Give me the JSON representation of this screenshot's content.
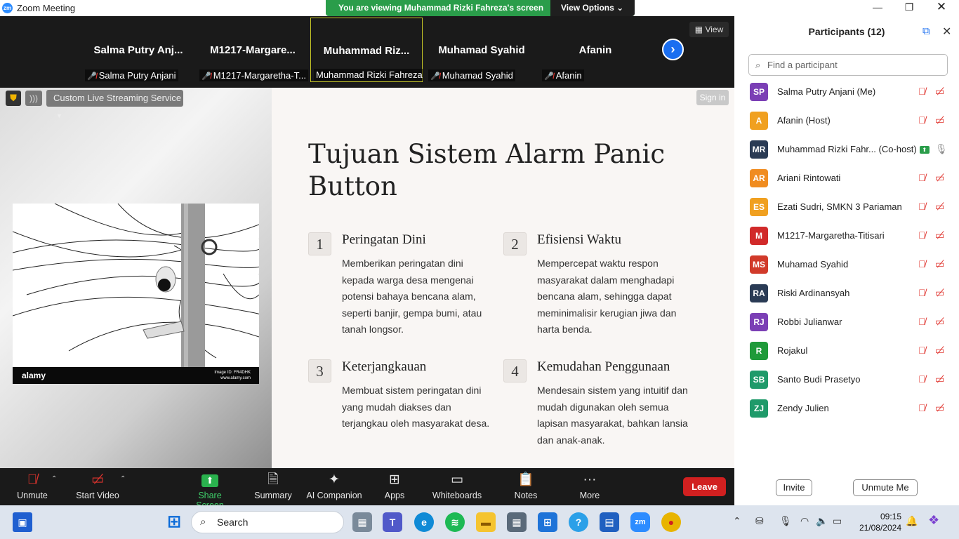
{
  "titlebar": {
    "app_icon": "zm",
    "title": "Zoom Meeting",
    "viewing": "You are viewing Muhammad Rizki Fahreza's screen",
    "view_options": "View Options"
  },
  "gallery": {
    "view_label": "View",
    "tiles": [
      {
        "display": "Salma  Putry  Anj...",
        "label": "Salma Putry Anjani",
        "muted": true
      },
      {
        "display": "M1217-Margare...",
        "label": "M1217-Margaretha-T...",
        "muted": true
      },
      {
        "display": "Muhammad  Riz...",
        "label": "Muhammad Rizki Fahreza",
        "muted": false
      },
      {
        "display": "Muhamad Syahid",
        "label": "Muhamad Syahid",
        "muted": true
      },
      {
        "display": "Afanin",
        "label": "Afanin",
        "muted": true
      }
    ]
  },
  "share": {
    "streaming_label": "Custom Live Streaming Service",
    "sign_in": "Sign in",
    "photo_brand": "alamy",
    "photo_id": "Image ID: FR4DHK\nwww.alamy.com",
    "slide": {
      "title": "Tujuan Sistem Alarm Panic Button",
      "items": [
        {
          "num": "1",
          "heading": "Peringatan Dini",
          "body": "Memberikan peringatan dini kepada warga desa mengenai potensi bahaya bencana alam, seperti banjir, gempa bumi, atau tanah longsor."
        },
        {
          "num": "2",
          "heading": "Efisiensi Waktu",
          "body": "Mempercepat waktu respon masyarakat dalam menghadapi bencana alam, sehingga dapat meminimalisir kerugian jiwa dan harta benda."
        },
        {
          "num": "3",
          "heading": "Keterjangkauan",
          "body": "Membuat sistem peringatan dini yang mudah diakses dan terjangkau oleh masyarakat desa."
        },
        {
          "num": "4",
          "heading": "Kemudahan Penggunaan",
          "body": "Mendesain sistem yang intuitif dan mudah digunakan oleh semua lapisan masyarakat, bahkan lansia dan anak-anak."
        }
      ]
    }
  },
  "toolbar": {
    "unmute": "Unmute",
    "start_video": "Start Video",
    "share_screen": "Share Screen",
    "summary": "Summary",
    "ai_companion": "AI Companion",
    "apps": "Apps",
    "whiteboards": "Whiteboards",
    "notes": "Notes",
    "more": "More",
    "leave": "Leave"
  },
  "participants": {
    "title": "Participants (12)",
    "search_placeholder": "Find a participant",
    "list": [
      {
        "initials": "SP",
        "name": "Salma Putry Anjani (Me)",
        "color": "#7b3fb5"
      },
      {
        "initials": "A",
        "name": "Afanin (Host)",
        "color": "#f0a020"
      },
      {
        "initials": "MR",
        "name": "Muhammad Rizki Fahr...  (Co-host)",
        "color": "#2a3b55"
      },
      {
        "initials": "AR",
        "name": "Ariani Rintowati",
        "color": "#f08c20"
      },
      {
        "initials": "ES",
        "name": "Ezati Sudri, SMKN 3 Pariaman",
        "color": "#f0a020"
      },
      {
        "initials": "M",
        "name": "M1217-Margaretha-Titisari",
        "color": "#d12a2a"
      },
      {
        "initials": "MS",
        "name": "Muhamad Syahid",
        "color": "#d13a2a"
      },
      {
        "initials": "RA",
        "name": "Riski Ardinansyah",
        "color": "#2a3b55"
      },
      {
        "initials": "RJ",
        "name": "Robbi Julianwar",
        "color": "#7b3fb5"
      },
      {
        "initials": "R",
        "name": "Rojakul",
        "color": "#1f9a3a"
      },
      {
        "initials": "SB",
        "name": "Santo Budi Prasetyo",
        "color": "#1f9a6a"
      },
      {
        "initials": "ZJ",
        "name": "Zendy Julien",
        "color": "#1f9a6a"
      }
    ],
    "invite": "Invite",
    "unmute_me": "Unmute Me"
  },
  "taskbar": {
    "search": "Search",
    "time": "09:15",
    "date": "21/08/2024"
  }
}
